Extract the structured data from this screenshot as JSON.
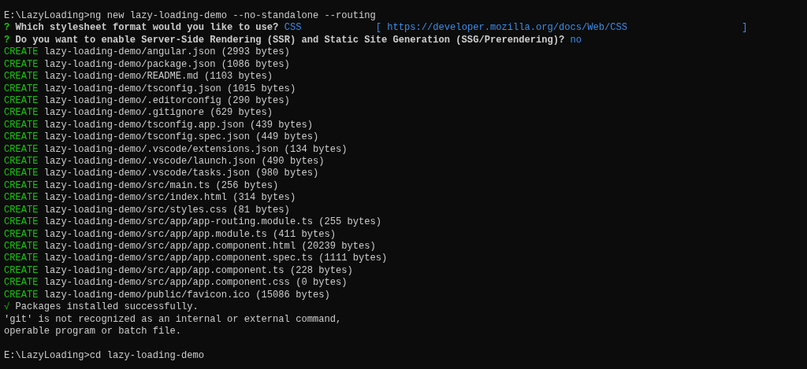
{
  "terminal": {
    "lines": [
      {
        "kind": "command",
        "prompt": "E:\\LazyLoading>",
        "command": "ng new lazy-loading-demo --no-standalone --routing"
      },
      {
        "kind": "question",
        "marker": "?",
        "question": "Which stylesheet format would you like to use?",
        "answer": "CSS",
        "hint": "[ https://developer.mozilla.org/docs/Web/CSS                    ]"
      },
      {
        "kind": "question",
        "marker": "?",
        "question": "Do you want to enable Server-Side Rendering (SSR) and Static Site Generation (SSG/Prerendering)?",
        "answer": "no"
      },
      {
        "kind": "create",
        "action": "CREATE",
        "text": "lazy-loading-demo/angular.json (2993 bytes)"
      },
      {
        "kind": "create",
        "action": "CREATE",
        "text": "lazy-loading-demo/package.json (1086 bytes)"
      },
      {
        "kind": "create",
        "action": "CREATE",
        "text": "lazy-loading-demo/README.md (1103 bytes)"
      },
      {
        "kind": "create",
        "action": "CREATE",
        "text": "lazy-loading-demo/tsconfig.json (1015 bytes)"
      },
      {
        "kind": "create",
        "action": "CREATE",
        "text": "lazy-loading-demo/.editorconfig (290 bytes)"
      },
      {
        "kind": "create",
        "action": "CREATE",
        "text": "lazy-loading-demo/.gitignore (629 bytes)"
      },
      {
        "kind": "create",
        "action": "CREATE",
        "text": "lazy-loading-demo/tsconfig.app.json (439 bytes)"
      },
      {
        "kind": "create",
        "action": "CREATE",
        "text": "lazy-loading-demo/tsconfig.spec.json (449 bytes)"
      },
      {
        "kind": "create",
        "action": "CREATE",
        "text": "lazy-loading-demo/.vscode/extensions.json (134 bytes)"
      },
      {
        "kind": "create",
        "action": "CREATE",
        "text": "lazy-loading-demo/.vscode/launch.json (490 bytes)"
      },
      {
        "kind": "create",
        "action": "CREATE",
        "text": "lazy-loading-demo/.vscode/tasks.json (980 bytes)"
      },
      {
        "kind": "create",
        "action": "CREATE",
        "text": "lazy-loading-demo/src/main.ts (256 bytes)"
      },
      {
        "kind": "create",
        "action": "CREATE",
        "text": "lazy-loading-demo/src/index.html (314 bytes)"
      },
      {
        "kind": "create",
        "action": "CREATE",
        "text": "lazy-loading-demo/src/styles.css (81 bytes)"
      },
      {
        "kind": "create",
        "action": "CREATE",
        "text": "lazy-loading-demo/src/app/app-routing.module.ts (255 bytes)"
      },
      {
        "kind": "create",
        "action": "CREATE",
        "text": "lazy-loading-demo/src/app/app.module.ts (411 bytes)"
      },
      {
        "kind": "create",
        "action": "CREATE",
        "text": "lazy-loading-demo/src/app/app.component.html (20239 bytes)"
      },
      {
        "kind": "create",
        "action": "CREATE",
        "text": "lazy-loading-demo/src/app/app.component.spec.ts (1111 bytes)"
      },
      {
        "kind": "create",
        "action": "CREATE",
        "text": "lazy-loading-demo/src/app/app.component.ts (228 bytes)"
      },
      {
        "kind": "create",
        "action": "CREATE",
        "text": "lazy-loading-demo/src/app/app.component.css (0 bytes)"
      },
      {
        "kind": "create",
        "action": "CREATE",
        "text": "lazy-loading-demo/public/favicon.ico (15086 bytes)"
      },
      {
        "kind": "success",
        "marker": "√",
        "text": "Packages installed successfully."
      },
      {
        "kind": "output",
        "text": "'git' is not recognized as an internal or external command,"
      },
      {
        "kind": "output",
        "text": "operable program or batch file."
      },
      {
        "kind": "blank"
      },
      {
        "kind": "command",
        "prompt": "E:\\LazyLoading>",
        "command": "cd lazy-loading-demo"
      }
    ]
  }
}
